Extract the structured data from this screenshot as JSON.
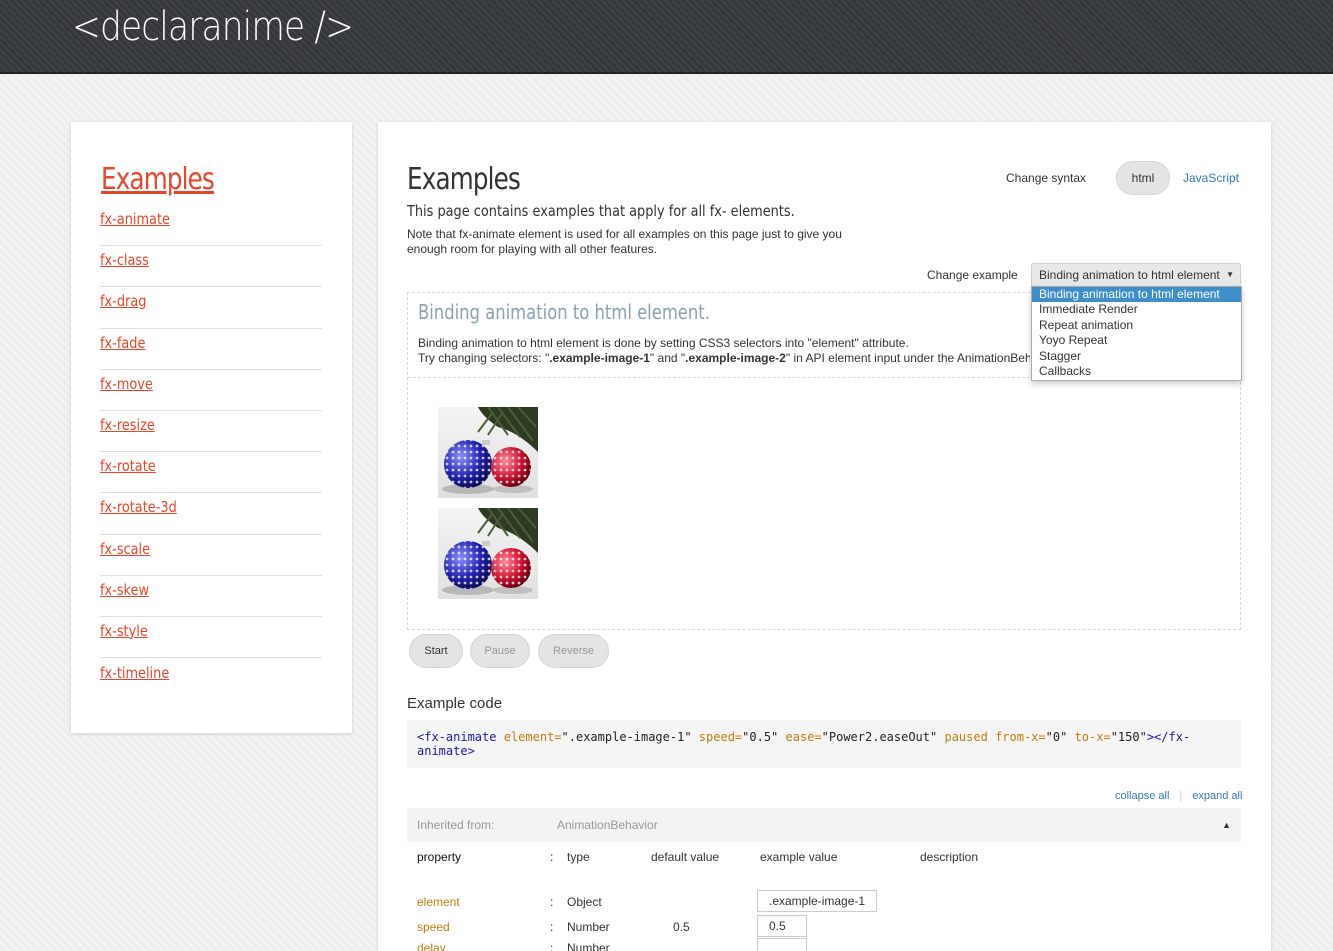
{
  "header": {
    "logo": "<declaranime />"
  },
  "sidebar": {
    "title": "Examples",
    "items": [
      "fx-animate",
      "fx-class",
      "fx-drag",
      "fx-fade",
      "fx-move",
      "fx-resize",
      "fx-rotate",
      "fx-rotate-3d",
      "fx-scale",
      "fx-skew",
      "fx-style",
      "fx-timeline"
    ]
  },
  "main": {
    "title": "Examples",
    "subtitle": "This page contains examples that apply for all fx- elements.",
    "note": "Note that fx-animate element is used for all examples on this page just to give you enough room for playing with all other features.",
    "syntax": {
      "label": "Change syntax",
      "html": "html",
      "javascript": "JavaScript"
    },
    "change_example": {
      "label": "Change example",
      "selected": "Binding animation to html element",
      "options": [
        "Binding animation to html element",
        "Immediate Render",
        "Repeat animation",
        "Yoyo Repeat",
        "Stagger",
        "Callbacks"
      ]
    },
    "example": {
      "title": "Binding animation to html element.",
      "desc_line1": "Binding animation to html element is done by setting CSS3 selectors into \"element\" attribute.",
      "desc_line2_a": "Try changing selectors: \"",
      "desc_sel1": ".example-image-1",
      "desc_line2_b": "\" and \"",
      "desc_sel2": ".example-image-2",
      "desc_line2_c": "\" in API element input under the AnimationBehavior"
    },
    "controls": {
      "start": "Start",
      "pause": "Pause",
      "reverse": "Reverse"
    },
    "code_label": "Example code",
    "code": {
      "open": "<fx-animate",
      "attr_element": "element=",
      "val_element": "\".example-image-1\"",
      "attr_speed": "speed=",
      "val_speed": "\"0.5\"",
      "attr_ease": "ease=",
      "val_ease": "\"Power2.easeOut\"",
      "attr_paused": "paused",
      "attr_fromx": "from-x=",
      "val_fromx": "\"0\"",
      "attr_tox": "to-x=",
      "val_tox": "\"150\"",
      "close": "></fx-animate>"
    },
    "links": {
      "collapse": "collapse all",
      "expand": "expand all"
    },
    "inherited": {
      "label": "Inherited from:",
      "class": "AnimationBehavior"
    },
    "table": {
      "headers": {
        "property": "property",
        "colon": ":",
        "type": "type",
        "default": "default value",
        "example": "example value",
        "description": "description"
      },
      "rows": [
        {
          "property": "element",
          "colon": ":",
          "type": "Object",
          "default": "",
          "example": ".example-image-1"
        },
        {
          "property": "speed",
          "colon": ":",
          "type": "Number",
          "default": "0.5",
          "example": "0.5"
        },
        {
          "property": "delay",
          "colon": ":",
          "type": "Number",
          "default": "",
          "example": ""
        }
      ]
    }
  },
  "colors": {
    "accent": "#e8452c",
    "link": "#3879b5",
    "selected_option": "#3d8ec9",
    "example_title": "#8aa2b2"
  },
  "icons": {
    "ornament_image": "christmas-ornaments-image",
    "select_arrow": "chevron-down-icon",
    "collapse_arrow": "triangle-up-icon"
  }
}
